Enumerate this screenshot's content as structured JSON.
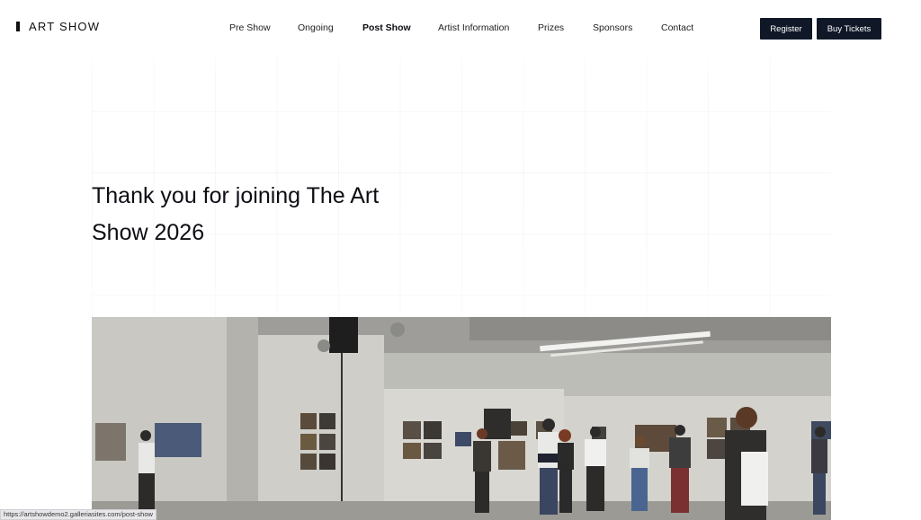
{
  "header": {
    "logo_text": "ART SHOW",
    "nav": [
      {
        "label": "Pre Show",
        "active": false
      },
      {
        "label": "Ongoing",
        "active": false
      },
      {
        "label": "Post Show",
        "active": true
      },
      {
        "label": "Artist Information",
        "active": false
      },
      {
        "label": "Prizes",
        "active": false
      },
      {
        "label": "Sponsors",
        "active": false
      },
      {
        "label": "Contact",
        "active": false
      }
    ],
    "register_label": "Register",
    "buy_tickets_label": "Buy Tickets"
  },
  "hero": {
    "title": "Thank you for joining The Art Show 2026"
  },
  "status_bar": {
    "url": "https://artshowdemo2.galleriasites.com/post-show"
  },
  "colors": {
    "button_bg": "#101828",
    "text": "#0f0f14"
  }
}
